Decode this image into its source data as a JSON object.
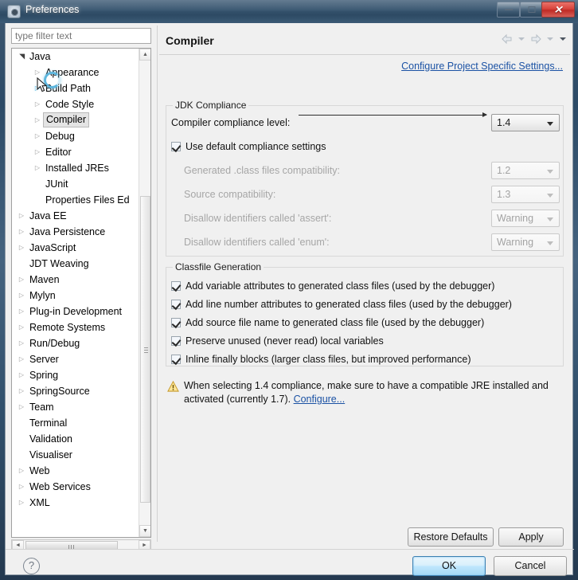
{
  "window": {
    "title": "Preferences",
    "icon": "preferences-gear-icon",
    "controls": {
      "minimize": "minimize-icon",
      "maximize": "maximize-icon",
      "close": "✕"
    }
  },
  "colors": {
    "titlebar": "#37556f",
    "close_button": "#d9443c",
    "link": "#1b52a4",
    "panel_bg": "#f0f0f0",
    "tree_bg": "#ffffff",
    "selection_bg": "#e4e4e4",
    "disabled_text": "#a6a6a6",
    "ok_button_border": "#3c7fb1",
    "hover_arrow": "#49b0e0"
  },
  "filter": {
    "placeholder": "type filter text",
    "value": ""
  },
  "tree": {
    "items": [
      {
        "label": "Java",
        "level": 0,
        "state": "expanded",
        "selected": false
      },
      {
        "label": "Appearance",
        "level": 1,
        "state": "collapsed",
        "selected": false
      },
      {
        "label": "Build Path",
        "level": 1,
        "state": "collapsed-hover",
        "selected": false
      },
      {
        "label": "Code Style",
        "level": 1,
        "state": "collapsed",
        "selected": false
      },
      {
        "label": "Compiler",
        "level": 1,
        "state": "collapsed",
        "selected": true
      },
      {
        "label": "Debug",
        "level": 1,
        "state": "collapsed",
        "selected": false
      },
      {
        "label": "Editor",
        "level": 1,
        "state": "collapsed",
        "selected": false
      },
      {
        "label": "Installed JREs",
        "level": 1,
        "state": "collapsed",
        "selected": false
      },
      {
        "label": "JUnit",
        "level": 1,
        "state": "leaf",
        "selected": false
      },
      {
        "label": "Properties Files Ed",
        "level": 1,
        "state": "leaf",
        "selected": false
      },
      {
        "label": "Java EE",
        "level": 0,
        "state": "collapsed",
        "selected": false
      },
      {
        "label": "Java Persistence",
        "level": 0,
        "state": "collapsed",
        "selected": false
      },
      {
        "label": "JavaScript",
        "level": 0,
        "state": "collapsed",
        "selected": false
      },
      {
        "label": "JDT Weaving",
        "level": 0,
        "state": "leaf",
        "selected": false
      },
      {
        "label": "Maven",
        "level": 0,
        "state": "collapsed",
        "selected": false
      },
      {
        "label": "Mylyn",
        "level": 0,
        "state": "collapsed",
        "selected": false
      },
      {
        "label": "Plug-in Development",
        "level": 0,
        "state": "collapsed",
        "selected": false
      },
      {
        "label": "Remote Systems",
        "level": 0,
        "state": "collapsed",
        "selected": false
      },
      {
        "label": "Run/Debug",
        "level": 0,
        "state": "collapsed",
        "selected": false
      },
      {
        "label": "Server",
        "level": 0,
        "state": "collapsed",
        "selected": false
      },
      {
        "label": "Spring",
        "level": 0,
        "state": "collapsed",
        "selected": false
      },
      {
        "label": "SpringSource",
        "level": 0,
        "state": "collapsed",
        "selected": false
      },
      {
        "label": "Team",
        "level": 0,
        "state": "collapsed",
        "selected": false
      },
      {
        "label": "Terminal",
        "level": 0,
        "state": "leaf",
        "selected": false
      },
      {
        "label": "Validation",
        "level": 0,
        "state": "leaf",
        "selected": false
      },
      {
        "label": "Visualiser",
        "level": 0,
        "state": "leaf",
        "selected": false
      },
      {
        "label": "Web",
        "level": 0,
        "state": "collapsed",
        "selected": false
      },
      {
        "label": "Web Services",
        "level": 0,
        "state": "collapsed",
        "selected": false
      },
      {
        "label": "XML",
        "level": 0,
        "state": "collapsed",
        "selected": false
      }
    ],
    "scrollbar_vertical": {
      "up": "▲",
      "down": "▼"
    },
    "scrollbar_horizontal": {
      "left": "◄",
      "right": "►"
    }
  },
  "page": {
    "title": "Compiler",
    "nav": {
      "back": "back-arrow-icon",
      "back_menu": "chevron-down-icon",
      "forward": "forward-arrow-icon",
      "forward_menu": "chevron-down-icon",
      "view_menu": "chevron-down-icon"
    },
    "project_specific_link": "Configure Project Specific Settings...",
    "jdk_compliance": {
      "title": "JDK Compliance",
      "compliance_level_label": "Compiler compliance level:",
      "compliance_level_value": "1.4",
      "use_default_label": "Use default compliance settings",
      "use_default_checked": true,
      "rows": [
        {
          "label": "Generated .class files compatibility:",
          "value": "1.2",
          "enabled": false
        },
        {
          "label": "Source compatibility:",
          "value": "1.3",
          "enabled": false
        },
        {
          "label": "Disallow identifiers called 'assert':",
          "value": "Warning",
          "enabled": false
        },
        {
          "label": "Disallow identifiers called 'enum':",
          "value": "Warning",
          "enabled": false
        }
      ]
    },
    "classfile_generation": {
      "title": "Classfile Generation",
      "options": [
        {
          "label": "Add variable attributes to generated class files (used by the debugger)",
          "checked": true
        },
        {
          "label": "Add line number attributes to generated class files (used by the debugger)",
          "checked": true
        },
        {
          "label": "Add source file name to generated class file (used by the debugger)",
          "checked": true
        },
        {
          "label": "Preserve unused (never read) local variables",
          "checked": true
        },
        {
          "label": "Inline finally blocks (larger class files, but improved performance)",
          "checked": true
        }
      ]
    },
    "warning": {
      "icon": "warning-triangle-icon",
      "text": "When selecting 1.4 compliance, make sure to have a compatible JRE installed and activated (currently 1.7). ",
      "link": "Configure..."
    },
    "restore_defaults_label": "Restore Defaults",
    "apply_label": "Apply"
  },
  "footer": {
    "help": "?",
    "ok_label": "OK",
    "cancel_label": "Cancel"
  }
}
